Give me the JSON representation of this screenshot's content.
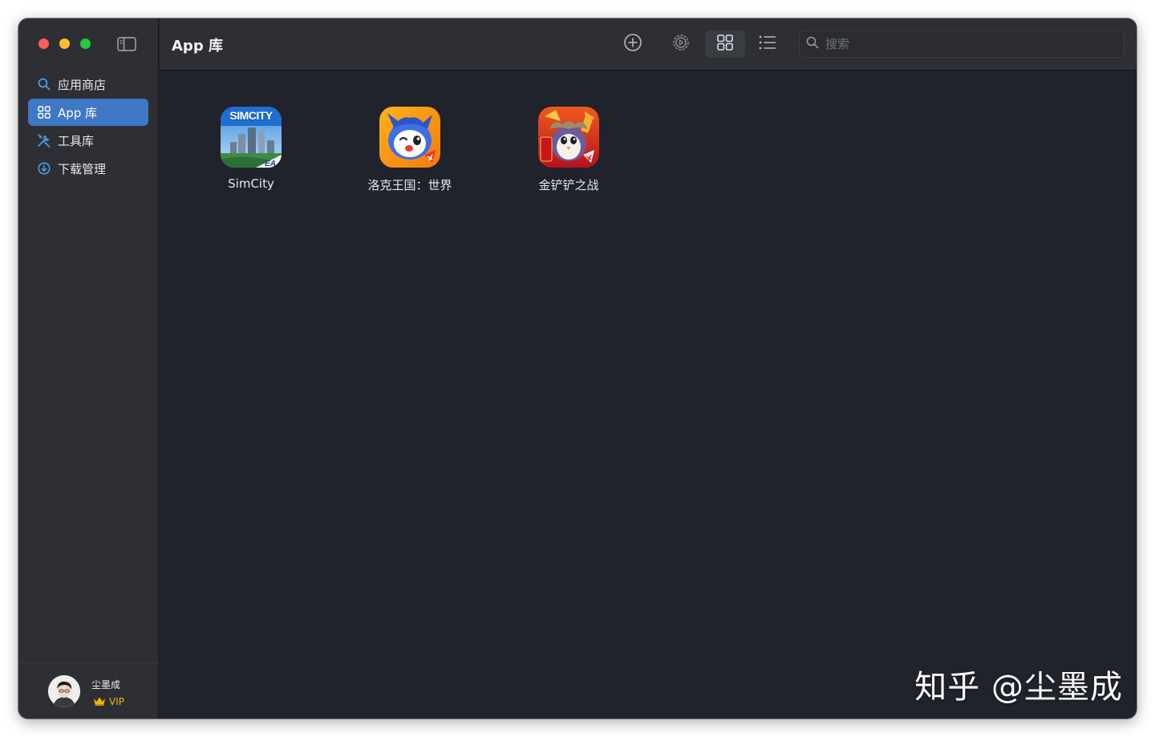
{
  "sidebar": {
    "items": [
      {
        "label": "应用商店",
        "icon": "search-icon",
        "active": false
      },
      {
        "label": "App 库",
        "icon": "grid-icon",
        "active": true
      },
      {
        "label": "工具库",
        "icon": "tools-icon",
        "active": false
      },
      {
        "label": "下载管理",
        "icon": "download-icon",
        "active": false
      }
    ],
    "user": {
      "name": "尘墨成",
      "badge": "VIP"
    }
  },
  "toolbar": {
    "title": "App 库",
    "search_placeholder": "搜索"
  },
  "apps": [
    {
      "name": "SimCity",
      "icon_text": "SIMCITY",
      "badge": "EA"
    },
    {
      "name": "洛克王国：世界"
    },
    {
      "name": "金铲铲之战"
    }
  ],
  "watermark": "知乎 @尘墨成",
  "colors": {
    "accent": "#3f78c4",
    "window_bg": "#20222c",
    "sidebar_bg": "#2d2f35",
    "vip": "#f2b705"
  }
}
